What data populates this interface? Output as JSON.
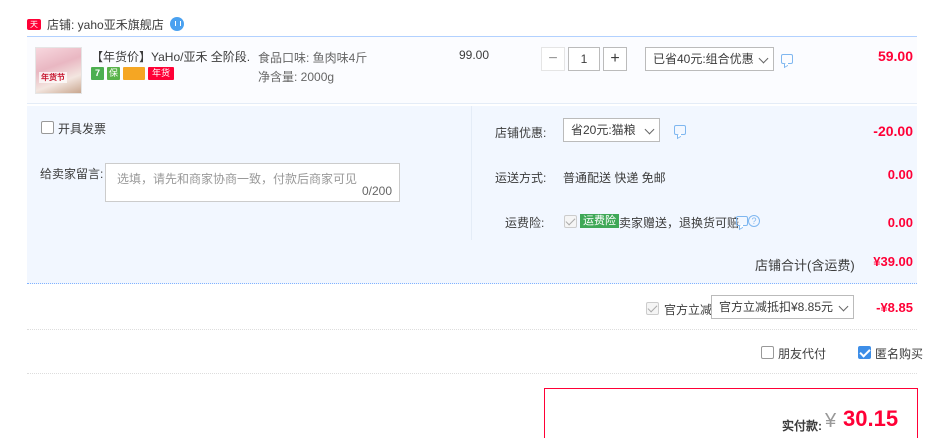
{
  "shop": {
    "badge": "天猫",
    "name": "店铺: yaho亚禾旗舰店"
  },
  "item": {
    "thumb_text": "年货节",
    "title": "【年货价】YaHo/亚禾 全阶段...",
    "icons": {
      "seven": "7",
      "green": "保",
      "card": "",
      "new_year": "年货"
    },
    "attr_flavor": "食品口味: 鱼肉味4斤",
    "attr_weight": "净含量: 2000g",
    "unit_price": "99.00",
    "quantity_minus": "−",
    "quantity": "1",
    "quantity_plus": "+",
    "discount_select": "已省40元:组合优惠",
    "subtotal": "59.00"
  },
  "options": {
    "invoice_label": "开具发票",
    "message_label": "给卖家留言:",
    "message_placeholder": "选填，请先和商家协商一致，付款后商家可见",
    "message_count": "0/200",
    "shop_discount_label": "店铺优惠:",
    "shop_discount_select": "省20元:猫粮",
    "shop_discount_amount": "-20.00",
    "shipping_label": "运送方式:",
    "shipping_value": "普通配送 快递 免邮",
    "shipping_amount": "0.00",
    "insurance_label": "运费险:",
    "insurance_tag": "运费险",
    "insurance_text": "卖家赠送，退换货可赔",
    "insurance_amount": "0.00",
    "help_glyph": "?",
    "shop_total_label": "店铺合计(含运费)",
    "shop_total_amount": "¥39.00"
  },
  "official": {
    "label": "官方立减",
    "select": "官方立减抵扣¥8.85元",
    "amount": "-¥8.85"
  },
  "extras": {
    "friend_pay_label": "朋友代付",
    "anonymous_label": "匿名购买"
  },
  "final": {
    "label": "实付款:",
    "currency": "¥",
    "amount": "30.15"
  }
}
